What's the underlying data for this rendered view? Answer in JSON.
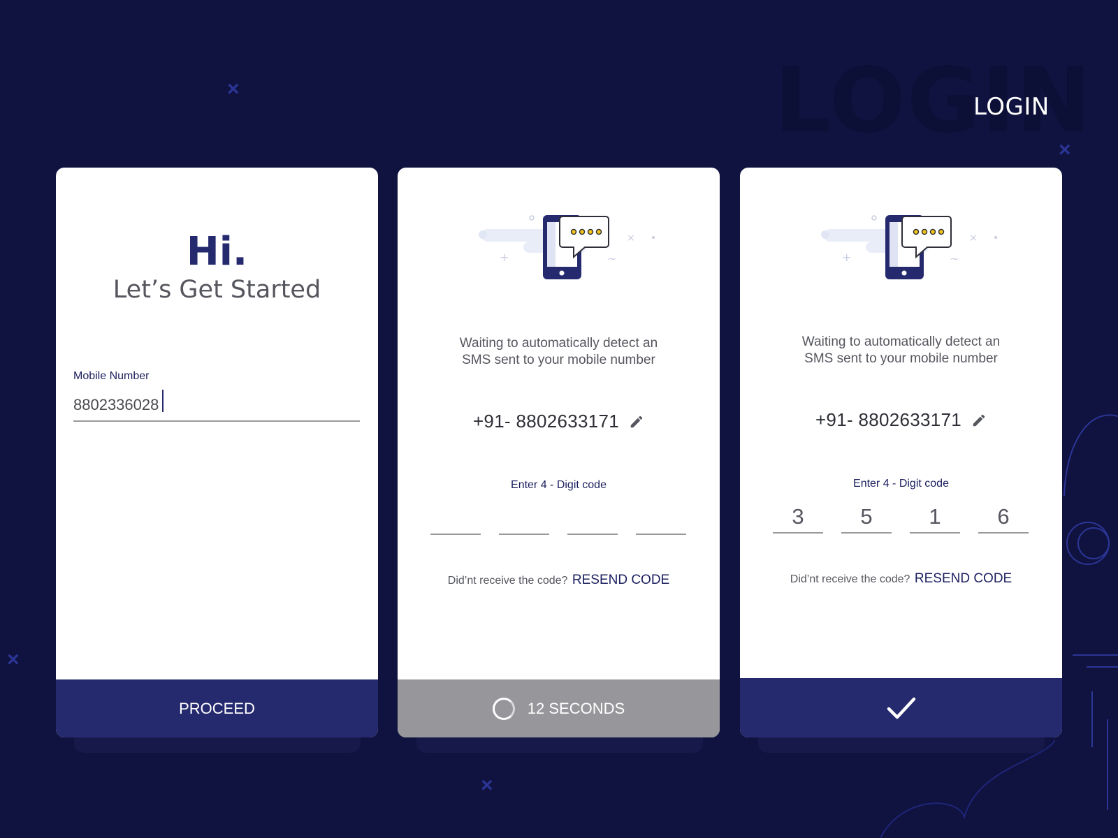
{
  "header": {
    "bg_word": "LOGIN",
    "title": "LOGIN"
  },
  "colors": {
    "background": "#10133f",
    "primary": "#252a6e",
    "disabled": "#97979b",
    "accent": "#f5c518"
  },
  "card1": {
    "greeting": "Hi.",
    "subtitle": "Let’s Get Started",
    "field_label": "Mobile Number",
    "field_value": "8802336028",
    "button_label": "PROCEED"
  },
  "card2": {
    "wait_line1": "Waiting to automatically detect an",
    "wait_line2": "SMS sent to your mobile number",
    "phone": "+91- 8802633171",
    "code_label": "Enter 4 - Digit code",
    "digits": [
      "",
      "",
      "",
      ""
    ],
    "resend_prompt": "Did’nt receive the code?",
    "resend_link": "RESEND CODE",
    "timer_label": "12 SECONDS",
    "icons": {
      "illustration": "phone-sms-icon",
      "edit": "pencil-icon",
      "spinner": "spinner-icon"
    }
  },
  "card3": {
    "wait_line1": "Waiting to automatically detect an",
    "wait_line2": "SMS sent to your mobile number",
    "phone": "+91- 8802633171",
    "code_label": "Enter 4 - Digit code",
    "digits": [
      "3",
      "5",
      "1",
      "6"
    ],
    "resend_prompt": "Did’nt receive the code?",
    "resend_link": "RESEND CODE",
    "icons": {
      "illustration": "phone-sms-icon",
      "edit": "pencil-icon",
      "submit": "checkmark-icon"
    }
  }
}
